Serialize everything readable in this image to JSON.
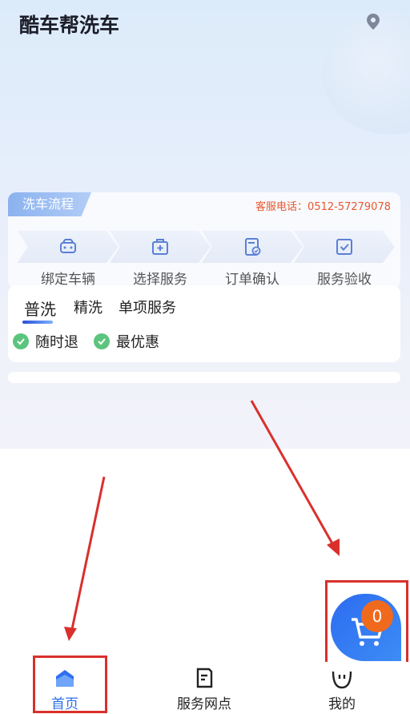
{
  "header": {
    "brand": "酷车帮洗车",
    "location_icon": "location-pin-icon"
  },
  "flow": {
    "tag_label": "洗车流程",
    "hotline": "客服电话：0512-57279078",
    "steps": [
      {
        "label": "绑定车辆",
        "icon": "car-icon"
      },
      {
        "label": "选择服务",
        "icon": "service-plus-icon"
      },
      {
        "label": "订单确认",
        "icon": "order-confirm-icon"
      },
      {
        "label": "服务验收",
        "icon": "checkbox-icon"
      }
    ]
  },
  "wash": {
    "tabs": [
      {
        "label": "普洗",
        "active": true
      },
      {
        "label": "精洗",
        "active": false
      },
      {
        "label": "单项服务",
        "active": false
      }
    ],
    "perks": [
      "随时退",
      "最优惠"
    ]
  },
  "cart": {
    "count": "0",
    "icon": "cart-icon"
  },
  "tabbar": {
    "items": [
      {
        "label": "首页",
        "icon": "home-icon",
        "active": true
      },
      {
        "label": "服务网点",
        "icon": "service-outlet-icon",
        "active": false
      },
      {
        "label": "我的",
        "icon": "profile-face-icon",
        "active": false
      }
    ]
  },
  "colors": {
    "accent": "#2a6de8",
    "hotline": "#e8572c",
    "check": "#5cc47e",
    "badge": "#f06a1e",
    "annotation": "#d9302c"
  }
}
